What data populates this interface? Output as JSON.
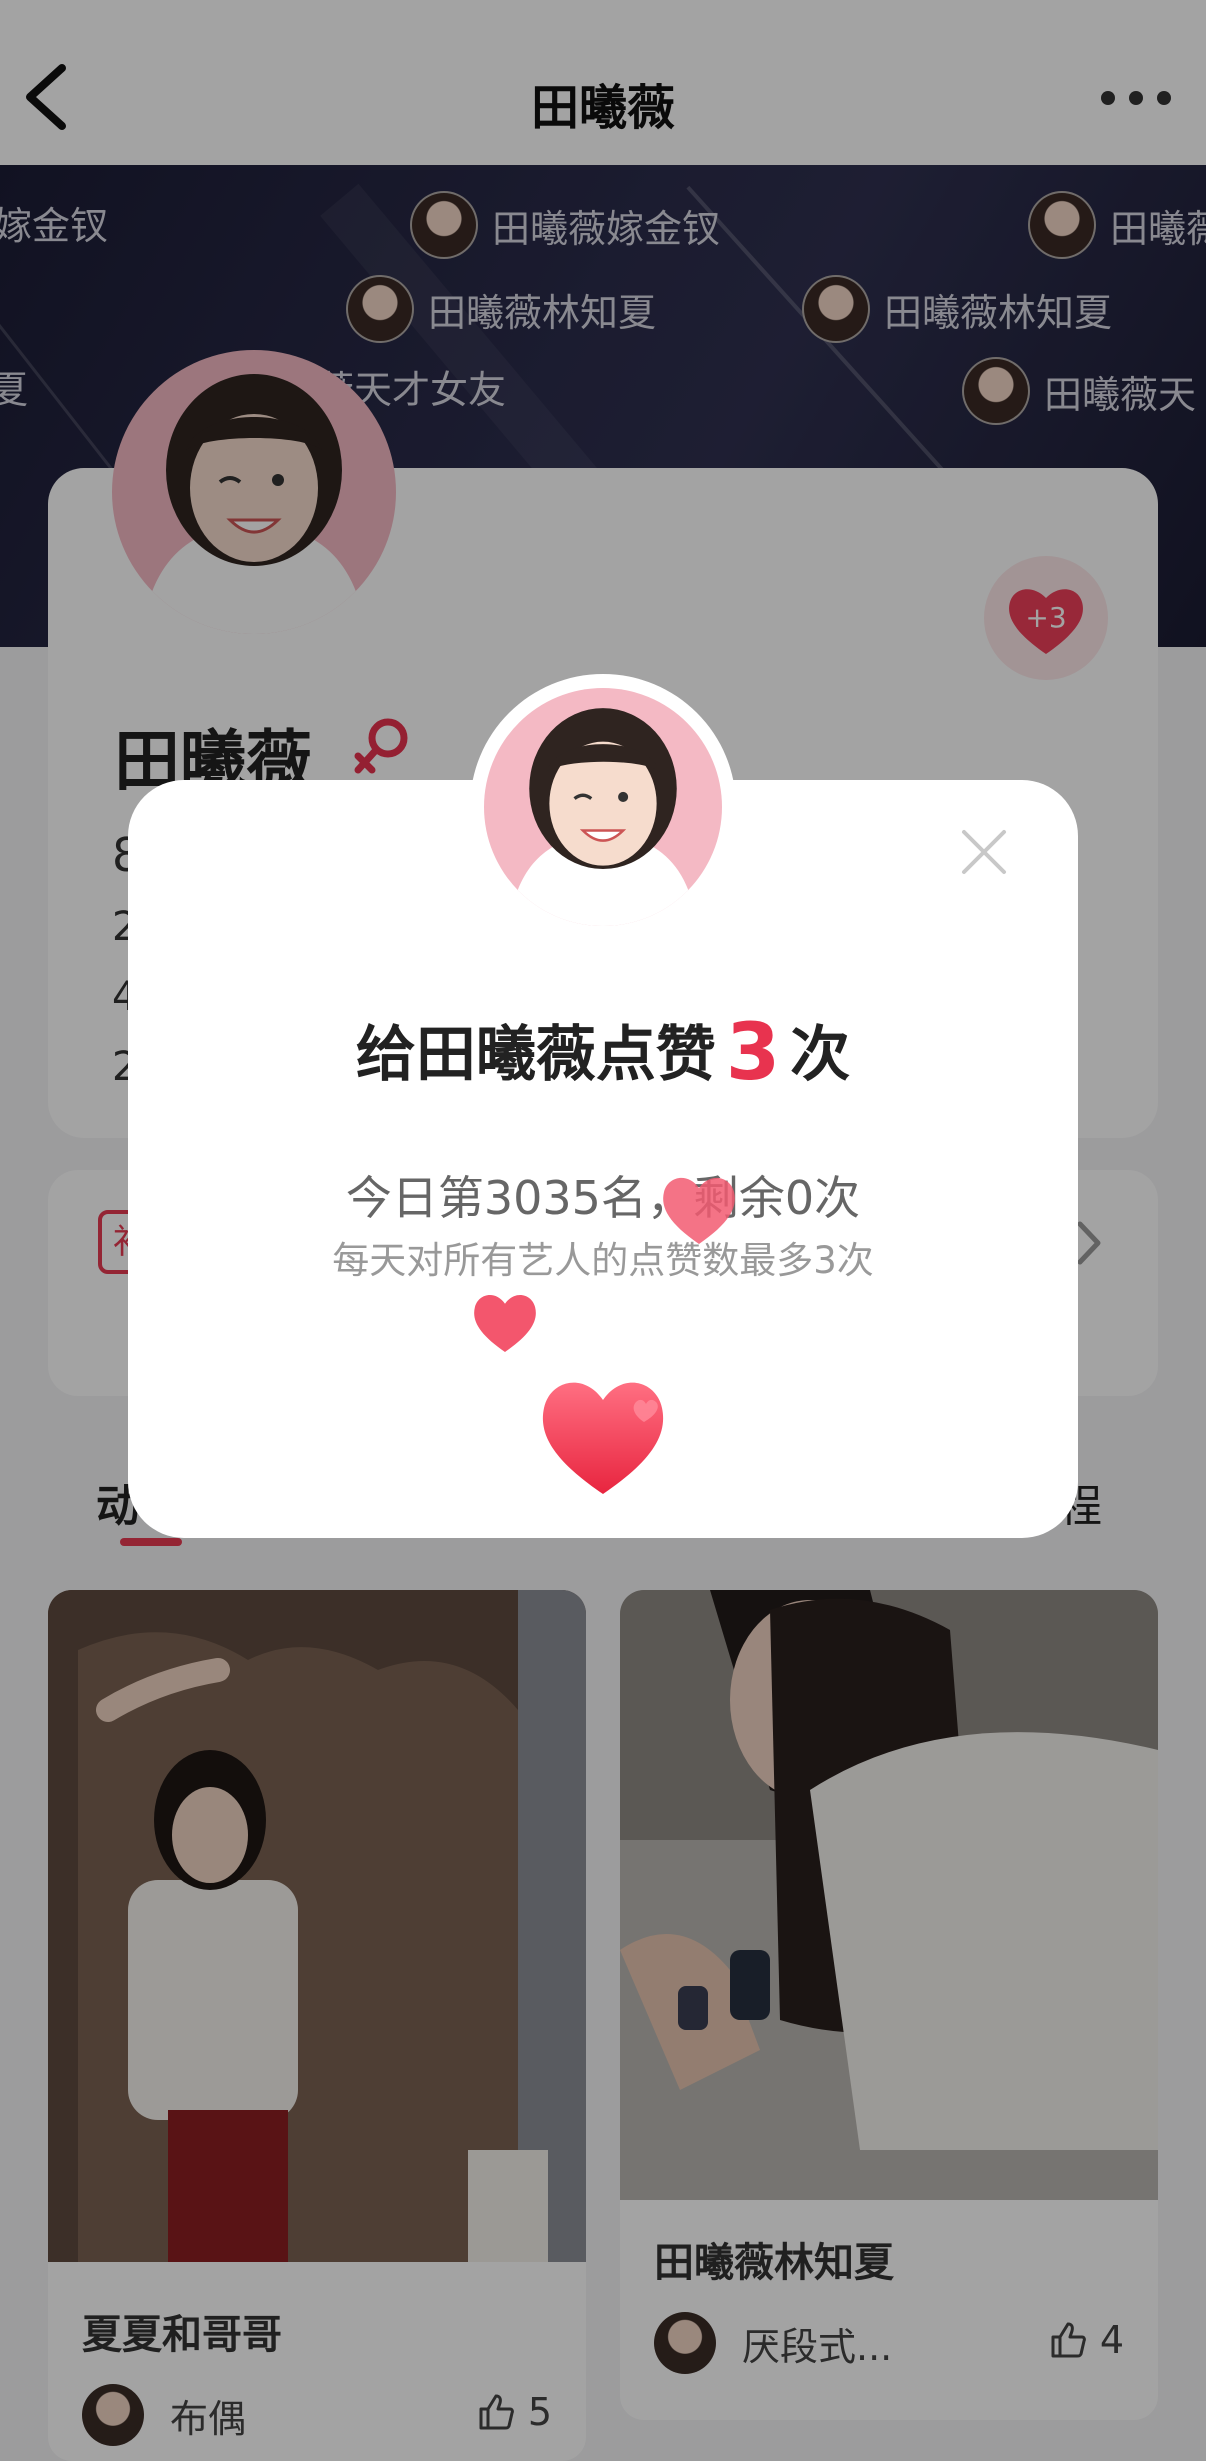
{
  "nav": {
    "title": "田曦薇"
  },
  "banner": {
    "chips": [
      {
        "text": "嫁金钗"
      },
      {
        "text": "田曦薇嫁金钗"
      },
      {
        "text": "田曦薇"
      },
      {
        "text": "田曦薇林知夏"
      },
      {
        "text": "田曦薇林知夏"
      },
      {
        "text": "夏"
      },
      {
        "text": "薇天才女友"
      },
      {
        "text": "田曦薇天"
      }
    ]
  },
  "profile": {
    "name": "田曦薇",
    "badge_text": "+3",
    "stats": [
      "8",
      "2",
      "4",
      "2"
    ]
  },
  "rank_card": {
    "tag_text": "补"
  },
  "tabs": {
    "left": "动",
    "right": "程"
  },
  "posts": [
    {
      "caption": "夏夏和哥哥",
      "author": "布偶",
      "likes": "5"
    },
    {
      "caption": "田曦薇林知夏",
      "author": "厌段式...",
      "likes": "4"
    }
  ],
  "modal": {
    "headline_before": "给田曦薇点赞",
    "headline_count": "3",
    "headline_after": "次",
    "rank_text": "今日第3035名，剩余0次",
    "note_text": "每天对所有艺人的点赞数最多3次"
  },
  "colors": {
    "accent": "#e8334f",
    "banner_dark": "#1c1d36"
  },
  "icons": [
    "back-arrow-icon",
    "more-dots-icon",
    "female-gender-icon",
    "heart-icon",
    "close-icon",
    "thumbs-up-icon",
    "chevron-right-icon"
  ]
}
